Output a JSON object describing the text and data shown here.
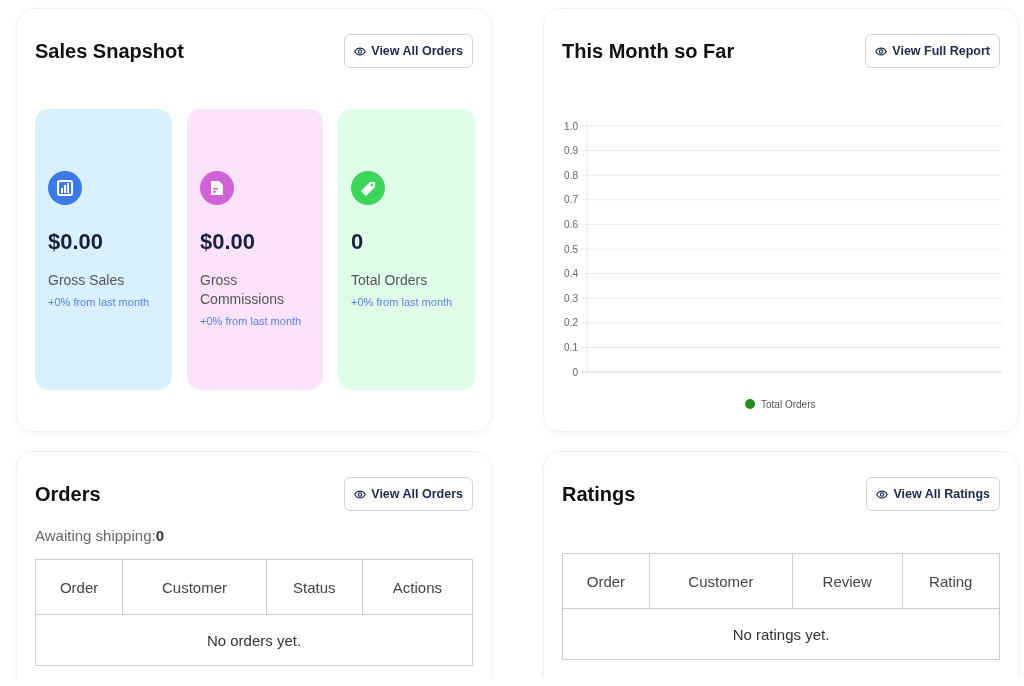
{
  "sales_snapshot": {
    "title": "Sales Snapshot",
    "button": "View All Orders",
    "stats": [
      {
        "kind": "chart",
        "color": "#3b7be8",
        "value": "$0.00",
        "label": "Gross Sales",
        "change": "+0% from last month"
      },
      {
        "kind": "document",
        "color": "#cf63d6",
        "value": "$0.00",
        "label": "Gross Commissions",
        "change": "+0% from last month"
      },
      {
        "kind": "tag",
        "color": "#3ed65a",
        "value": "0",
        "label": "Total Orders",
        "change": "+0% from last month"
      }
    ]
  },
  "this_month": {
    "title": "This Month so Far",
    "button": "View Full Report",
    "chart_data": {
      "type": "line",
      "grid": true,
      "ylim": [
        0,
        1
      ],
      "yticks": [
        0,
        {
          "value": 0.1,
          "label": "0.1"
        },
        {
          "value": 0.2,
          "label": "0.2"
        },
        {
          "value": 0.3,
          "label": "0.3"
        },
        {
          "value": 0.4,
          "label": "0.4"
        },
        {
          "value": 0.5,
          "label": "0.5"
        },
        {
          "value": 0.6,
          "label": "0.6"
        },
        {
          "value": 0.7,
          "label": "0.7"
        },
        {
          "value": 0.8,
          "label": "0.8"
        },
        {
          "value": 0.9,
          "label": "0.9"
        },
        {
          "value": 1,
          "label": "1.0"
        }
      ],
      "series": [
        {
          "name": "Total Orders",
          "color": "#228b22"
        }
      ]
    }
  },
  "orders": {
    "title": "Orders",
    "button": "View All Orders",
    "awaiting_label": "Awaiting shipping:",
    "awaiting_count": "0",
    "columns": [
      "Order",
      "Customer",
      "Status",
      "Actions"
    ],
    "empty": "No orders yet."
  },
  "ratings": {
    "title": "Ratings",
    "button": "View All Ratings",
    "columns": [
      "Order",
      "Customer",
      "Review",
      "Rating"
    ],
    "empty": "No ratings yet."
  }
}
